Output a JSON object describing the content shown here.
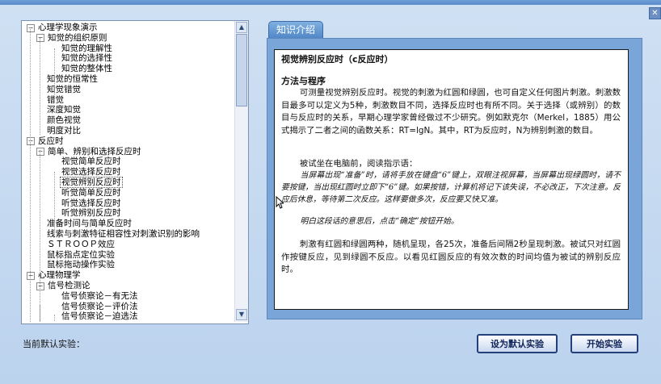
{
  "window": {
    "close_glyph": "✕"
  },
  "tree": {
    "items": [
      {
        "level": 0,
        "label": "心理学现象演示",
        "expander": "−"
      },
      {
        "level": 1,
        "label": "知觉的组织原则",
        "expander": "−"
      },
      {
        "level": 2,
        "label": "知觉的理解性"
      },
      {
        "level": 2,
        "label": "知觉的选择性"
      },
      {
        "level": 2,
        "label": "知觉的整体性"
      },
      {
        "level": 1,
        "label": "知觉的恒常性"
      },
      {
        "level": 1,
        "label": "知觉错觉"
      },
      {
        "level": 1,
        "label": "错觉"
      },
      {
        "level": 1,
        "label": "深度知觉"
      },
      {
        "level": 1,
        "label": "颜色视觉"
      },
      {
        "level": 1,
        "label": "明度对比"
      },
      {
        "level": 0,
        "label": "反应时",
        "expander": "−"
      },
      {
        "level": 1,
        "label": "简单、辨别和选择反应时",
        "expander": "−"
      },
      {
        "level": 2,
        "label": "视觉简单反应时"
      },
      {
        "level": 2,
        "label": "视觉选择反应时"
      },
      {
        "level": 2,
        "label": "视觉辨别反应时",
        "selected": true
      },
      {
        "level": 2,
        "label": "听觉简单反应时"
      },
      {
        "level": 2,
        "label": "听觉选择反应时"
      },
      {
        "level": 2,
        "label": "听觉辨别反应时"
      },
      {
        "level": 1,
        "label": "准备时间与简单反应时"
      },
      {
        "level": 1,
        "label": "线索与刺激特征相容性对刺激识别的影响"
      },
      {
        "level": 1,
        "label": "ＳＴＲＯＯＰ效应"
      },
      {
        "level": 1,
        "label": "鼠标指点定位实验"
      },
      {
        "level": 1,
        "label": "鼠标拖动操作实验"
      },
      {
        "level": 0,
        "label": "心理物理学",
        "expander": "−"
      },
      {
        "level": 1,
        "label": "信号检测论",
        "expander": "−"
      },
      {
        "level": 2,
        "label": "信号侦察论－有无法"
      },
      {
        "level": 2,
        "label": "信号侦察论－评价法"
      },
      {
        "level": 2,
        "label": "信号侦察论－迫选法"
      }
    ],
    "scroll_up_glyph": "▲",
    "scroll_down_glyph": "▼"
  },
  "tab": {
    "label": "知识介绍"
  },
  "doc": {
    "title": "视觉辨别反应时（c反应时）",
    "section": "方法与程序",
    "para1": "可测量视觉辨别反应时。视觉的刺激为红圆和绿圆，也可自定义任何图片刺激。刺激数目最多可以定义为5种，刺激数目不同，选择反应时也有所不同。关于选择（或辨别）的数目与反应时的关系，早期心理学家曾经做过不少研究。例如默克尔（Merkel，1885）用公式揭示了二者之间的函数关系：RT=lgN。其中，RT为反应时，N为辨别刺激的数目。",
    "para2": "被试坐在电脑前，阅读指示语：",
    "instruction1": "当屏幕出现“准备”时，请将手放在键盘“6”键上，双眼注视屏幕，当屏幕出现绿圆时，请不要按键，当出现红圆时立即下“6”键。如果按错，计算机将记下该失误，不必改正，下次注意。反应后休息，等待第二次反应。这样要做多次，反应要又快又准。",
    "instruction2": "明白这段话的意思后，点击“确定”按钮开始。",
    "para3": "刺激有红圆和绿圆两种，随机呈现，各25次，准备后间隔2秒呈现刺激。被试只对红圆作按键反应，见到绿圆不反应。以看见红圆反应的有效次数的时间均值为被试的辨别反应时。"
  },
  "footer": {
    "default_label": "当前默认实验：",
    "set_default_button": "设为默认实验",
    "start_button": "开始实验"
  }
}
